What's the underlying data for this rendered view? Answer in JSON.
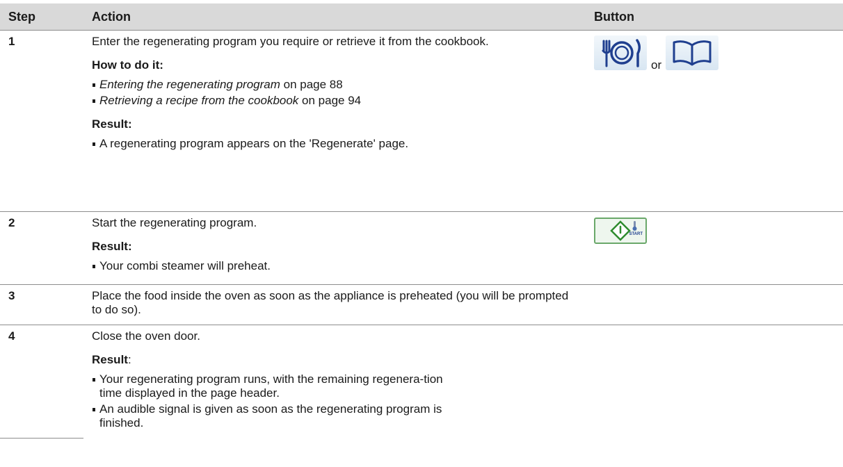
{
  "table": {
    "headers": {
      "step": "Step",
      "action": "Action",
      "button": "Button"
    },
    "rows": [
      {
        "step": "1",
        "instruction": "Enter the regenerating program you require or retrieve it from the cookbook.",
        "how_to_heading": "How to do it:",
        "how_to": [
          {
            "link": "Entering the regenerating program",
            "page_text": " on page 88"
          },
          {
            "link": "Retrieving a recipe from the cookbook",
            "page_text": " on page 94"
          }
        ],
        "result_heading": "Result:",
        "results": [
          "A regenerating program appears on the 'Regenerate' page."
        ],
        "or_text": "or",
        "icons": [
          "plate-cutlery-icon",
          "cookbook-icon"
        ]
      },
      {
        "step": "2",
        "instruction": "Start the regenerating program.",
        "result_heading": "Result:",
        "results": [
          "Your combi steamer will preheat."
        ],
        "start_label": "START",
        "icons": [
          "start-button-icon"
        ]
      },
      {
        "step": "3",
        "instruction": "Place the food inside the oven as soon as the appliance is preheated (you will be prompted to do so)."
      },
      {
        "step": "4",
        "instruction": "Close the oven door.",
        "result_heading": "Result",
        "result_colon": ":",
        "results": [
          "Your regenerating program runs, with the remaining regenera-tion time displayed in the page header.",
          "An audible signal is given as soon as the regenerating program is finished."
        ]
      }
    ]
  },
  "colors": {
    "header_bg": "#d9d9d9",
    "icon_blue": "#1f3f8f",
    "start_green": "#2e8b2e"
  }
}
